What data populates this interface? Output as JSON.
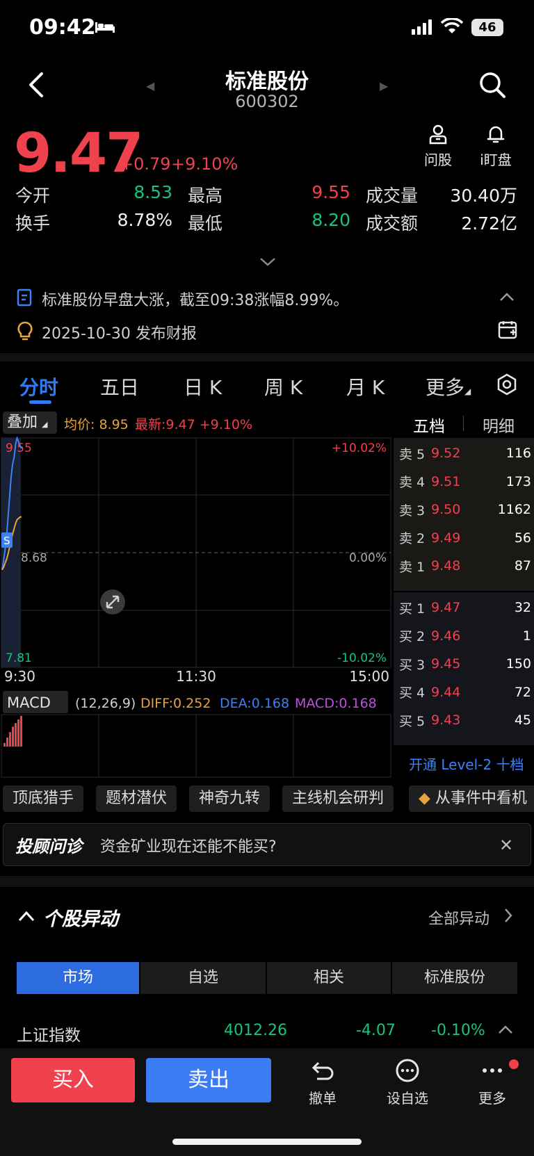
{
  "status_bar": {
    "time": "09:42",
    "battery": "46"
  },
  "header": {
    "stock_name": "标准股份",
    "stock_code": "600302"
  },
  "quote": {
    "price": "9.47",
    "change_abs": "+0.79",
    "change_pct": "+9.10%"
  },
  "header_tools": {
    "ask_stock": "问股",
    "watch_plate": "i盯盘"
  },
  "stats": {
    "open_label": "今开",
    "open": "8.53",
    "high_label": "最高",
    "high": "9.55",
    "volume_label": "成交量",
    "volume": "30.40万",
    "turnover_label": "换手",
    "turnover": "8.78%",
    "low_label": "最低",
    "low": "8.20",
    "amount_label": "成交额",
    "amount": "2.72亿"
  },
  "news": {
    "headline": "标准股份早盘大涨，截至09:38涨幅8.99%。",
    "report": "2025-10-30 发布财报"
  },
  "tabs": [
    "分时",
    "五日",
    "日 K",
    "周 K",
    "月 K",
    "更多"
  ],
  "chart_toolbar": {
    "overlay": "叠加",
    "avg_label": "均价: 8.95",
    "latest_label": "最新:9.47 +9.10%",
    "five_level": "五档",
    "detail": "明细"
  },
  "chart_data": {
    "type": "line",
    "y_left_ticks": [
      "9.55",
      "8.68",
      "7.81"
    ],
    "y_right_ticks": [
      "+10.02%",
      "0.00%",
      "-10.02%"
    ],
    "x_ticks": [
      "9:30",
      "11:30",
      "15:00"
    ],
    "ylim": [
      7.81,
      9.55
    ],
    "prev_close": 8.68,
    "series": [
      {
        "name": "最新",
        "color": "#3b82f6",
        "values": [
          8.55,
          8.62,
          8.7,
          8.8,
          8.95,
          9.1,
          9.25,
          9.35,
          9.4,
          9.5,
          9.55,
          9.52,
          9.49,
          9.47
        ]
      },
      {
        "name": "均价",
        "color": "#e8a33a",
        "values": [
          8.55,
          8.57,
          8.6,
          8.63,
          8.67,
          8.72,
          8.77,
          8.82,
          8.86,
          8.9,
          8.93,
          8.94,
          8.95,
          8.95
        ]
      }
    ],
    "marker": "S",
    "macd": {
      "label": "MACD",
      "params": "(12,26,9)",
      "diff": "DIFF:0.252",
      "dea": "DEA:0.168",
      "macd": "MACD:0.168",
      "hist": [
        0.02,
        0.05,
        0.08,
        0.11,
        0.13,
        0.15,
        0.17
      ]
    }
  },
  "order_book": {
    "asks": [
      {
        "label": "卖 5",
        "price": "9.52",
        "vol": "116"
      },
      {
        "label": "卖 4",
        "price": "9.51",
        "vol": "173"
      },
      {
        "label": "卖 3",
        "price": "9.50",
        "vol": "1162"
      },
      {
        "label": "卖 2",
        "price": "9.49",
        "vol": "56"
      },
      {
        "label": "卖 1",
        "price": "9.48",
        "vol": "87"
      }
    ],
    "bids": [
      {
        "label": "买 1",
        "price": "9.47",
        "vol": "32"
      },
      {
        "label": "买 2",
        "price": "9.46",
        "vol": "1"
      },
      {
        "label": "买 3",
        "price": "9.45",
        "vol": "150"
      },
      {
        "label": "买 4",
        "price": "9.44",
        "vol": "72"
      },
      {
        "label": "买 5",
        "price": "9.43",
        "vol": "45"
      }
    ],
    "level2_link": "开通 Level-2 十档"
  },
  "tool_chips": [
    "顶底猎手",
    "题材潜伏",
    "神奇九转",
    "主线机会研判",
    "从事件中看机"
  ],
  "advisor": {
    "brand": "投顾问诊",
    "question": "资金矿业现在还能不能买?",
    "close": "✕"
  },
  "abnormal": {
    "title": "个股异动",
    "all_link": "全部异动",
    "segments": [
      "市场",
      "自选",
      "相关",
      "标准股份"
    ],
    "index": {
      "name": "上证指数",
      "value": "4012.26",
      "change": "-4.07",
      "pct": "-0.10%"
    }
  },
  "bottom_bar": {
    "buy": "买入",
    "sell": "卖出",
    "undo": "撤单",
    "add_watch": "设自选",
    "more": "更多"
  }
}
